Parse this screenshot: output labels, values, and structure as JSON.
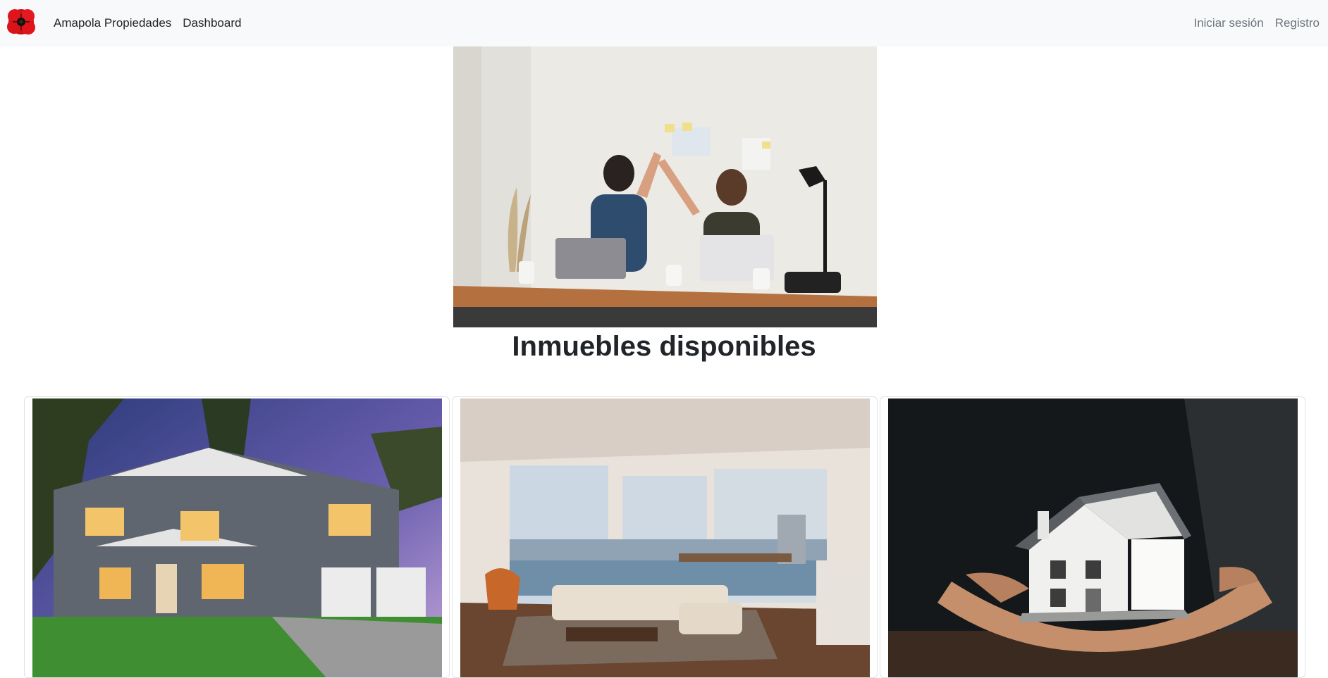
{
  "navbar": {
    "brand_logo_icon": "poppy-flower-icon",
    "brand_label": "Amapola Propiedades",
    "dashboard_label": "Dashboard",
    "login_label": "Iniciar sesión",
    "register_label": "Registro"
  },
  "hero": {
    "image_icon": "office-high-five-photo"
  },
  "main": {
    "title": "Inmuebles disponibles"
  },
  "cards": [
    {
      "image_icon": "suburban-house-photo"
    },
    {
      "image_icon": "living-room-interior-photo"
    },
    {
      "image_icon": "house-model-in-hands-photo"
    }
  ],
  "colors": {
    "navbar_bg": "#f8f9fa",
    "nav_link": "#212529",
    "nav_link_muted": "#6c757d",
    "logo_red": "#e0151b"
  }
}
